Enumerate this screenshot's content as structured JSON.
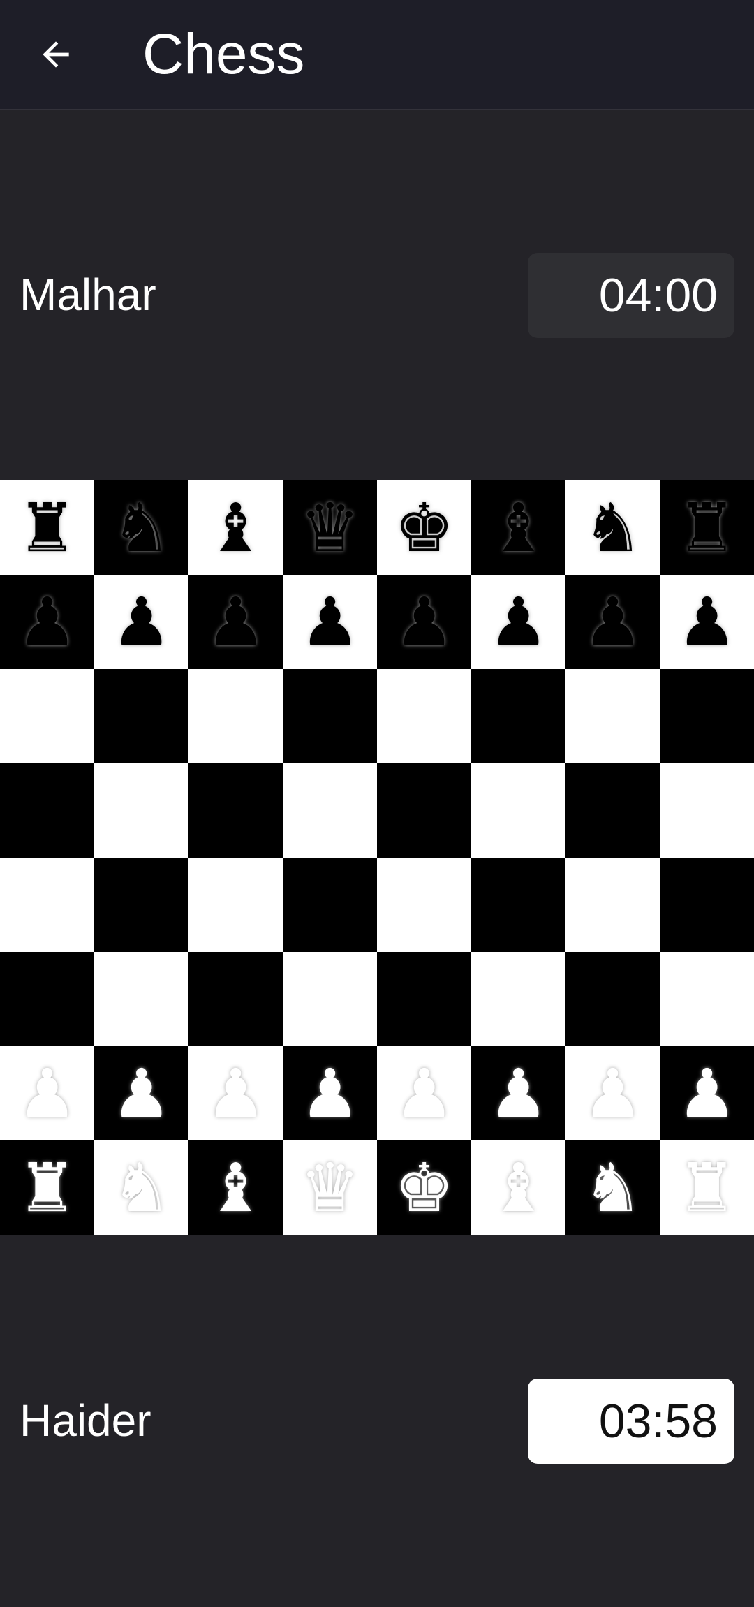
{
  "app_bar": {
    "title": "Chess",
    "back_icon": "arrow-left-icon"
  },
  "opponent": {
    "name": "Malhar",
    "clock": "04:00",
    "active": false
  },
  "player": {
    "name": "Haider",
    "clock": "03:58",
    "active": true
  },
  "board": {
    "light_color": "#ffffff",
    "dark_color": "#000000",
    "ranks": [
      [
        {
          "p": "rook",
          "c": "black"
        },
        {
          "p": "knight",
          "c": "black"
        },
        {
          "p": "bishop",
          "c": "black"
        },
        {
          "p": "queen",
          "c": "black"
        },
        {
          "p": "king",
          "c": "black"
        },
        {
          "p": "bishop",
          "c": "black"
        },
        {
          "p": "knight",
          "c": "black"
        },
        {
          "p": "rook",
          "c": "black"
        }
      ],
      [
        {
          "p": "pawn",
          "c": "black"
        },
        {
          "p": "pawn",
          "c": "black"
        },
        {
          "p": "pawn",
          "c": "black"
        },
        {
          "p": "pawn",
          "c": "black"
        },
        {
          "p": "pawn",
          "c": "black"
        },
        {
          "p": "pawn",
          "c": "black"
        },
        {
          "p": "pawn",
          "c": "black"
        },
        {
          "p": "pawn",
          "c": "black"
        }
      ],
      [
        null,
        null,
        null,
        null,
        null,
        null,
        null,
        null
      ],
      [
        null,
        null,
        null,
        null,
        null,
        null,
        null,
        null
      ],
      [
        null,
        null,
        null,
        null,
        null,
        null,
        null,
        null
      ],
      [
        null,
        null,
        null,
        null,
        null,
        null,
        null,
        null
      ],
      [
        {
          "p": "pawn",
          "c": "white"
        },
        {
          "p": "pawn",
          "c": "white"
        },
        {
          "p": "pawn",
          "c": "white"
        },
        {
          "p": "pawn",
          "c": "white"
        },
        {
          "p": "pawn",
          "c": "white"
        },
        {
          "p": "pawn",
          "c": "white"
        },
        {
          "p": "pawn",
          "c": "white"
        },
        {
          "p": "pawn",
          "c": "white"
        }
      ],
      [
        {
          "p": "rook",
          "c": "white"
        },
        {
          "p": "knight",
          "c": "white"
        },
        {
          "p": "bishop",
          "c": "white"
        },
        {
          "p": "queen",
          "c": "white"
        },
        {
          "p": "king",
          "c": "white"
        },
        {
          "p": "bishop",
          "c": "white"
        },
        {
          "p": "knight",
          "c": "white"
        },
        {
          "p": "rook",
          "c": "white"
        }
      ]
    ]
  }
}
